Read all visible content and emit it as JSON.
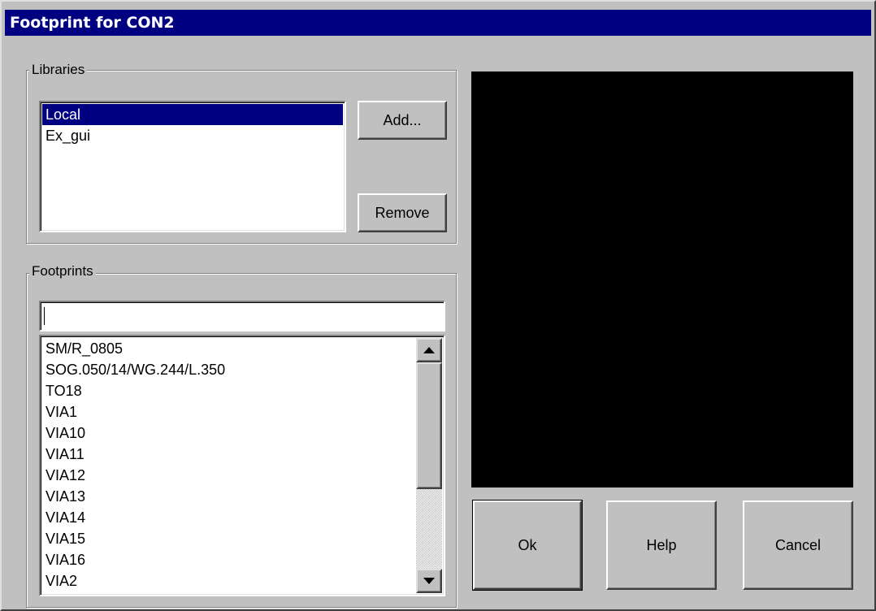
{
  "window": {
    "title": "Footprint for CON2"
  },
  "libraries": {
    "label": "Libraries",
    "items": [
      {
        "label": "Local",
        "selected": true
      },
      {
        "label": "Ex_gui",
        "selected": false
      }
    ],
    "add_label": "Add...",
    "remove_label": "Remove"
  },
  "footprints": {
    "label": "Footprints",
    "filter_value": "",
    "items": [
      "SM/R_0805",
      "SOG.050/14/WG.244/L.350",
      "TO18",
      "VIA1",
      "VIA10",
      "VIA11",
      "VIA12",
      "VIA13",
      "VIA14",
      "VIA15",
      "VIA16",
      "VIA2"
    ],
    "scroll_icons": {
      "up": "arrow-up-icon",
      "down": "arrow-down-icon"
    }
  },
  "preview": {
    "background": "#000000"
  },
  "buttons": {
    "ok_label": "Ok",
    "help_label": "Help",
    "cancel_label": "Cancel"
  },
  "colors": {
    "title_bar": "#000080",
    "selection": "#000080",
    "face": "#c0c0c0"
  }
}
